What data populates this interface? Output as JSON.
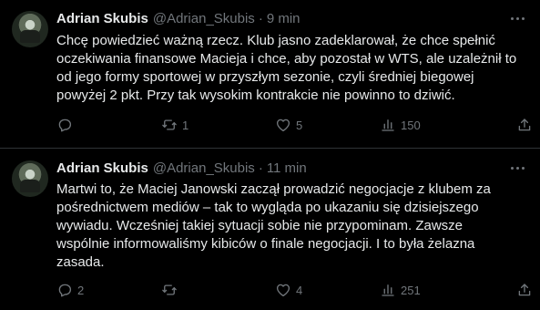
{
  "tweets": [
    {
      "author_name": "Adrian Skubis",
      "handle": "@Adrian_Skubis",
      "separator": "·",
      "time": "9 min",
      "text": "Chcę powiedzieć ważną rzecz. Klub jasno zadeklarował, że chce spełnić\noczekiwania finansowe Macieja i chce, aby pozostał w WTS, ale uzależnił to\nod jego formy sportowej w przyszłym sezonie, czyli średniej biegowej\npowyżej 2 pkt. Przy tak wysokim kontrakcie nie powinno to dziwić.",
      "replies": "",
      "retweets": "1",
      "likes": "5",
      "views": "150"
    },
    {
      "author_name": "Adrian Skubis",
      "handle": "@Adrian_Skubis",
      "separator": "·",
      "time": "11 min",
      "text": "Martwi to, że Maciej Janowski zaczął prowadzić negocjacje z klubem za\npośrednictwem mediów – tak to wygląda po ukazaniu się dzisiejszego\nwywiadu. Wcześniej takiej sytuacji sobie nie przypominam. Zawsze\nwspólnie informowaliśmy kibiców o finale negocjacji. I to była żelazna\nzasada.",
      "replies": "2",
      "retweets": "",
      "likes": "4",
      "views": "251"
    }
  ],
  "icons": {
    "reply": "reply-icon",
    "retweet": "retweet-icon",
    "like": "like-icon",
    "views": "views-icon",
    "share": "share-icon",
    "more": "more-icon"
  },
  "colors": {
    "background": "#000000",
    "text": "#e7e9ea",
    "secondary": "#71767b",
    "divider": "#2f3336"
  }
}
